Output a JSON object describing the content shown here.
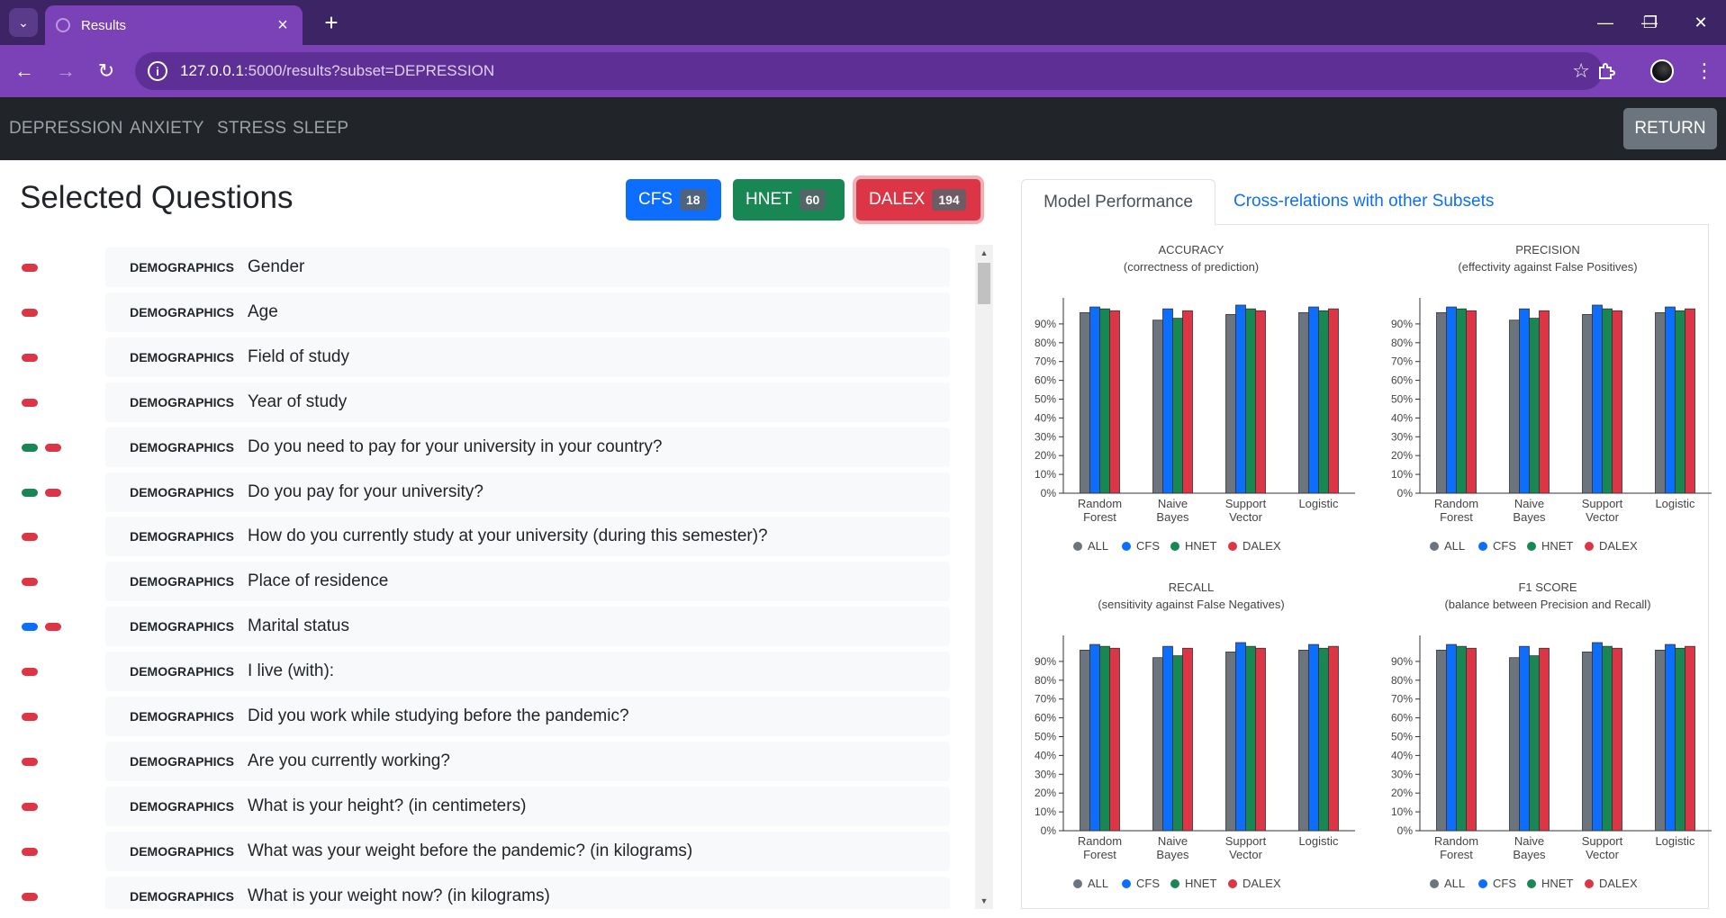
{
  "browser": {
    "tab_title": "Results",
    "url_host": "127.0.0.1",
    "url_path": ":5000/results?subset=DEPRESSION"
  },
  "navbar": {
    "links": [
      "DEPRESSION",
      "ANXIETY",
      "STRESS",
      "SLEEP"
    ],
    "return_label": "RETURN"
  },
  "questions_panel": {
    "title": "Selected Questions",
    "filters": [
      {
        "label": "CFS",
        "count": "18",
        "color": "#0d6efd"
      },
      {
        "label": "HNET",
        "count": "60",
        "color": "#198754"
      },
      {
        "label": "DALEX",
        "count": "194",
        "color": "#dc3545"
      }
    ],
    "questions": [
      {
        "category": "DEMOGRAPHICS",
        "text": "Gender",
        "marks": [
          "dalex"
        ]
      },
      {
        "category": "DEMOGRAPHICS",
        "text": "Age",
        "marks": [
          "dalex"
        ]
      },
      {
        "category": "DEMOGRAPHICS",
        "text": "Field of study",
        "marks": [
          "dalex"
        ]
      },
      {
        "category": "DEMOGRAPHICS",
        "text": "Year of study",
        "marks": [
          "dalex"
        ]
      },
      {
        "category": "DEMOGRAPHICS",
        "text": "Do you need to pay for your university in your country?",
        "marks": [
          "hnet",
          "dalex"
        ]
      },
      {
        "category": "DEMOGRAPHICS",
        "text": "Do you pay for your university?",
        "marks": [
          "hnet",
          "dalex"
        ]
      },
      {
        "category": "DEMOGRAPHICS",
        "text": "How do you currently study at your university (during this semester)?",
        "marks": [
          "dalex"
        ]
      },
      {
        "category": "DEMOGRAPHICS",
        "text": "Place of residence",
        "marks": [
          "dalex"
        ]
      },
      {
        "category": "DEMOGRAPHICS",
        "text": "Marital status",
        "marks": [
          "cfs",
          "dalex"
        ]
      },
      {
        "category": "DEMOGRAPHICS",
        "text": "I live (with):",
        "marks": [
          "dalex"
        ]
      },
      {
        "category": "DEMOGRAPHICS",
        "text": "Did you work while studying before the pandemic?",
        "marks": [
          "dalex"
        ]
      },
      {
        "category": "DEMOGRAPHICS",
        "text": "Are you currently working?",
        "marks": [
          "dalex"
        ]
      },
      {
        "category": "DEMOGRAPHICS",
        "text": "What is your height? (in centimeters)",
        "marks": [
          "dalex"
        ]
      },
      {
        "category": "DEMOGRAPHICS",
        "text": "What was your weight before the pandemic? (in kilograms)",
        "marks": [
          "dalex"
        ]
      },
      {
        "category": "DEMOGRAPHICS",
        "text": "What is your weight now? (in kilograms)",
        "marks": [
          "dalex"
        ]
      }
    ]
  },
  "tabs": {
    "active": "Model Performance",
    "other": "Cross-relations with other Subsets"
  },
  "colors": {
    "all": "#6c757d",
    "cfs": "#0d6efd",
    "hnet": "#198754",
    "dalex": "#dc3545"
  },
  "chart_data": [
    {
      "type": "bar",
      "title": "ACCURACY",
      "subtitle": "(correctness of prediction)",
      "categories": [
        "Random Forest",
        "Naive Bayes",
        "Support Vector",
        "Logistic"
      ],
      "ylim": [
        0,
        100
      ],
      "yticks": [
        "0%",
        "10%",
        "20%",
        "30%",
        "40%",
        "50%",
        "60%",
        "70%",
        "80%",
        "90%"
      ],
      "series": [
        {
          "name": "ALL",
          "values": [
            96,
            92,
            95,
            96
          ]
        },
        {
          "name": "CFS",
          "values": [
            99,
            98,
            100,
            99
          ]
        },
        {
          "name": "HNET",
          "values": [
            98,
            93,
            98,
            97
          ]
        },
        {
          "name": "DALEX",
          "values": [
            97,
            97,
            97,
            98
          ]
        }
      ]
    },
    {
      "type": "bar",
      "title": "PRECISION",
      "subtitle": "(effectivity against False Positives)",
      "categories": [
        "Random Forest",
        "Naive Bayes",
        "Support Vector",
        "Logistic"
      ],
      "ylim": [
        0,
        100
      ],
      "yticks": [
        "0%",
        "10%",
        "20%",
        "30%",
        "40%",
        "50%",
        "60%",
        "70%",
        "80%",
        "90%"
      ],
      "series": [
        {
          "name": "ALL",
          "values": [
            96,
            92,
            95,
            96
          ]
        },
        {
          "name": "CFS",
          "values": [
            99,
            98,
            100,
            99
          ]
        },
        {
          "name": "HNET",
          "values": [
            98,
            93,
            98,
            97
          ]
        },
        {
          "name": "DALEX",
          "values": [
            97,
            97,
            97,
            98
          ]
        }
      ]
    },
    {
      "type": "bar",
      "title": "RECALL",
      "subtitle": "(sensitivity against False Negatives)",
      "categories": [
        "Random Forest",
        "Naive Bayes",
        "Support Vector",
        "Logistic"
      ],
      "ylim": [
        0,
        100
      ],
      "yticks": [
        "0%",
        "10%",
        "20%",
        "30%",
        "40%",
        "50%",
        "60%",
        "70%",
        "80%",
        "90%"
      ],
      "series": [
        {
          "name": "ALL",
          "values": [
            96,
            92,
            95,
            96
          ]
        },
        {
          "name": "CFS",
          "values": [
            99,
            98,
            100,
            99
          ]
        },
        {
          "name": "HNET",
          "values": [
            98,
            93,
            98,
            97
          ]
        },
        {
          "name": "DALEX",
          "values": [
            97,
            97,
            97,
            98
          ]
        }
      ]
    },
    {
      "type": "bar",
      "title": "F1 SCORE",
      "subtitle": "(balance between Precision and Recall)",
      "categories": [
        "Random Forest",
        "Naive Bayes",
        "Support Vector",
        "Logistic"
      ],
      "ylim": [
        0,
        100
      ],
      "yticks": [
        "0%",
        "10%",
        "20%",
        "30%",
        "40%",
        "50%",
        "60%",
        "70%",
        "80%",
        "90%"
      ],
      "series": [
        {
          "name": "ALL",
          "values": [
            96,
            92,
            95,
            96
          ]
        },
        {
          "name": "CFS",
          "values": [
            99,
            98,
            100,
            99
          ]
        },
        {
          "name": "HNET",
          "values": [
            98,
            93,
            98,
            97
          ]
        },
        {
          "name": "DALEX",
          "values": [
            97,
            97,
            97,
            98
          ]
        }
      ]
    }
  ]
}
